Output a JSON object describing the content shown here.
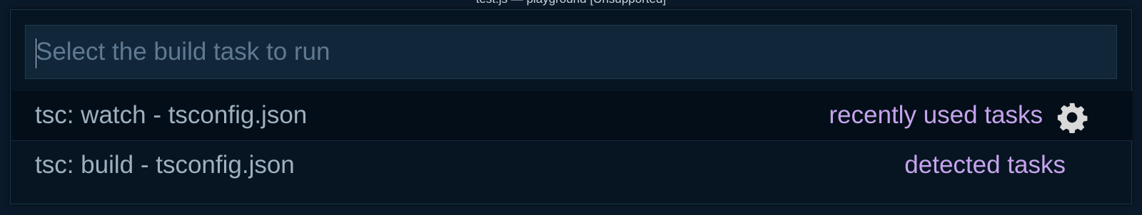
{
  "window": {
    "title": "test.js — playground [Unsupported]"
  },
  "quick_pick": {
    "input": {
      "value": "",
      "placeholder": "Select the build task to run"
    },
    "items": [
      {
        "label": "tsc: watch - tsconfig.json",
        "detail": "recently used tasks",
        "icon": "gear-icon",
        "focused": true
      },
      {
        "label": "tsc: build - tsconfig.json",
        "detail": "detected tasks",
        "focused": false
      }
    ]
  },
  "colors": {
    "background": "#061321",
    "input_background": "#112639",
    "label_text": "#9fb0be",
    "detail_text": "#c6a4ec",
    "placeholder_text": "#5f7a90",
    "gear_icon": "#d9d9d9"
  }
}
